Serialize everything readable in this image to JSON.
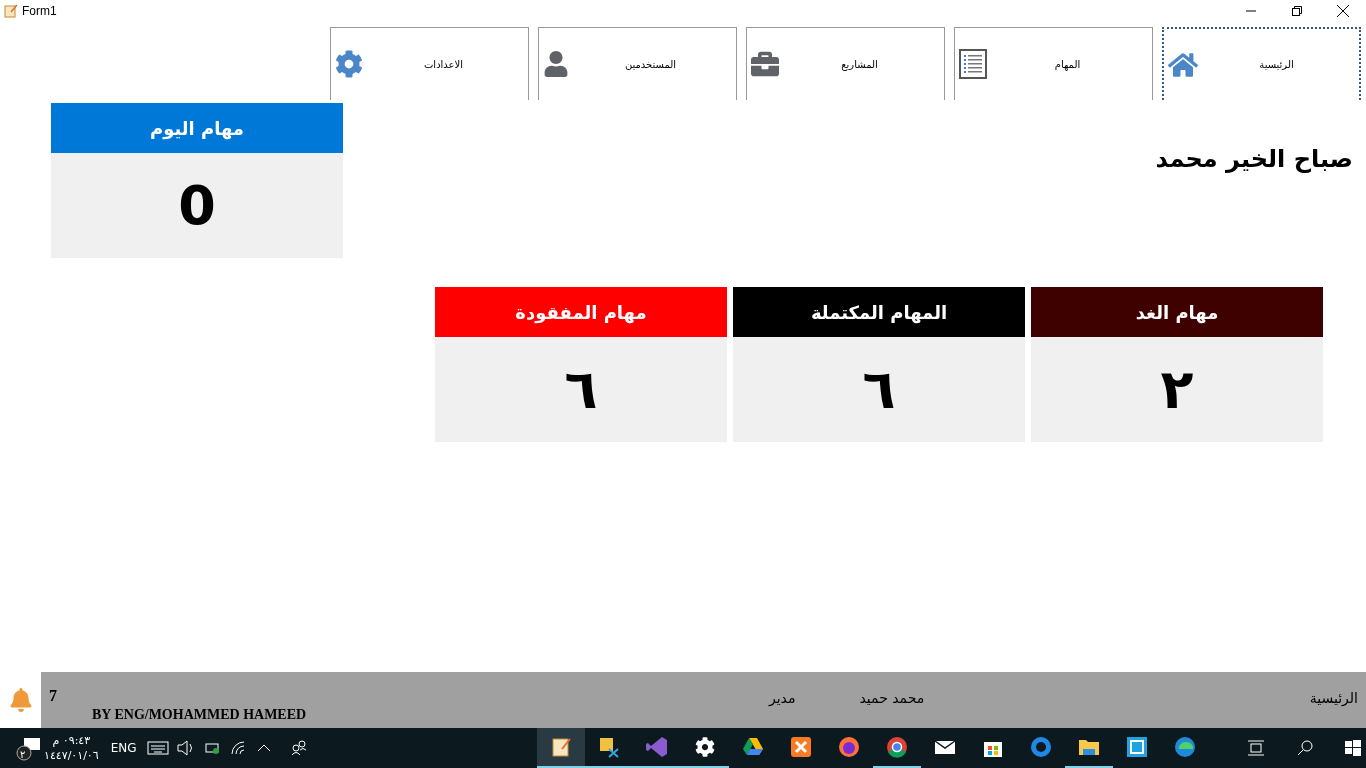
{
  "window": {
    "title": "Form1"
  },
  "nav_tabs": [
    {
      "label": "الرئيسية",
      "kind": "home",
      "selected": true
    },
    {
      "label": "المهام",
      "kind": "list",
      "selected": false
    },
    {
      "label": "المشاريع",
      "kind": "briefcase",
      "selected": false
    },
    {
      "label": "المستخدمين",
      "kind": "user",
      "selected": false
    },
    {
      "label": "الاعدادات",
      "kind": "gear",
      "selected": false
    }
  ],
  "greeting": "صباح الخير محمد",
  "today_card": {
    "title": "مهام اليوم",
    "value": "0",
    "color": "#0078d7"
  },
  "stat_cards": [
    {
      "title": "مهام الغد",
      "value": "٢",
      "color": "#3f0000"
    },
    {
      "title": "المهام المكتملة",
      "value": "٦",
      "color": "#000000"
    },
    {
      "title": "مهام المفقودة",
      "value": "٦",
      "color": "#ff0000"
    }
  ],
  "status_bar": {
    "notifications": "7",
    "credit": "BY ENG/MOHAMMED HAMEED",
    "role": "مدير",
    "user": "محمد حميد",
    "page": "الرئيسية"
  },
  "taskbar": {
    "notification_count": "٢",
    "time": "٠٩:٤٣ م",
    "date": "١٤٤٧/٠١/٠٦",
    "language": "ENG",
    "apps": [
      {
        "kind": "notepad",
        "running": true,
        "active": true
      },
      {
        "kind": "database",
        "running": true,
        "active": false
      },
      {
        "kind": "studio",
        "running": true,
        "active": false
      },
      {
        "kind": "settings",
        "running": true,
        "active": false
      },
      {
        "kind": "drive",
        "running": false,
        "active": false
      },
      {
        "kind": "xampp",
        "running": false,
        "active": false
      },
      {
        "kind": "firefox",
        "running": false,
        "active": false
      },
      {
        "kind": "chrome",
        "running": true,
        "active": false
      },
      {
        "kind": "mail",
        "running": false,
        "active": false
      },
      {
        "kind": "store",
        "running": false,
        "active": false
      },
      {
        "kind": "video",
        "running": false,
        "active": false
      },
      {
        "kind": "folder",
        "running": true,
        "active": false
      },
      {
        "kind": "brackets",
        "running": false,
        "active": false
      },
      {
        "kind": "edge",
        "running": false,
        "active": false
      }
    ]
  }
}
